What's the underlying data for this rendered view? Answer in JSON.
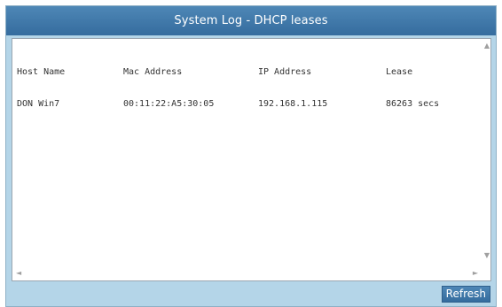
{
  "window": {
    "title": "System Log - DHCP leases"
  },
  "dhcp_table": {
    "columns": [
      "Host Name",
      "Mac Address",
      "IP Address",
      "Lease"
    ],
    "rows": [
      [
        "DON Win7",
        "00:11:22:A5:30:05",
        "192.168.1.115",
        "86263 secs"
      ]
    ]
  },
  "actions": {
    "refresh_label": "Refresh"
  },
  "scrollbar_icons": {
    "up": "▲",
    "down": "▼",
    "left": "◄",
    "right": "►"
  }
}
